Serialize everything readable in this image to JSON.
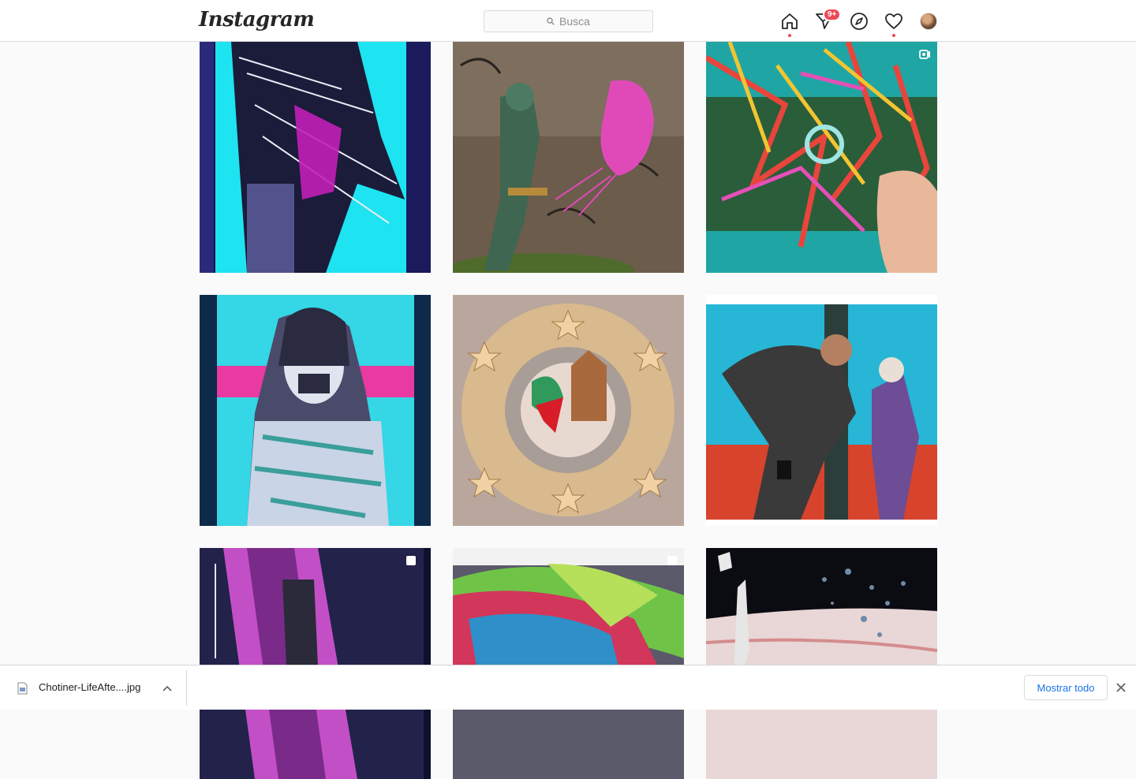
{
  "app": {
    "logo_text": "Instagram",
    "search_placeholder": "Busca",
    "notification_count": "9+",
    "accent_color": "#ed4956"
  },
  "nav_icons": [
    "home-icon",
    "direct-icon",
    "explore-icon",
    "activity-icon",
    "profile-avatar"
  ],
  "posts": [
    {
      "subject": "cyan figure with long dark hair",
      "multi": false
    },
    {
      "subject": "graffiti figure holding pink creature",
      "multi": false
    },
    {
      "subject": "colorful puzzle artwork with hand",
      "multi": false,
      "video": true
    },
    {
      "subject": "cyan and pink portrait with mask",
      "multi": false
    },
    {
      "subject": "star cookies wreath around plate",
      "multi": false
    },
    {
      "subject": "artist painting mural",
      "multi": false
    },
    {
      "subject": "purple cosmic figure",
      "multi": true
    },
    {
      "subject": "green wall mural with helmet",
      "multi": true
    },
    {
      "subject": "astronaut on snowy landscape",
      "multi": false
    }
  ],
  "downloads": {
    "file_name": "Chotiner-LifeAfte....jpg",
    "show_all_label": "Mostrar todo"
  }
}
